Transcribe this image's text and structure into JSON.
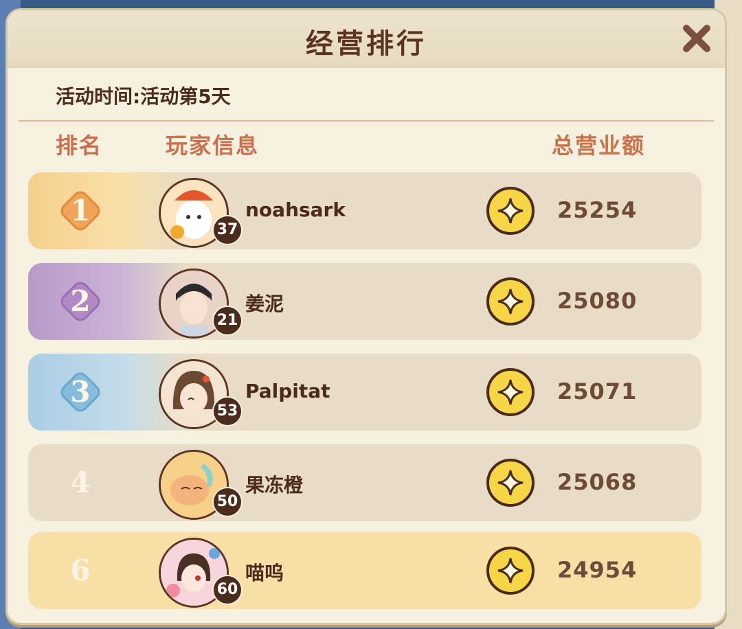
{
  "title": "经营排行",
  "event_time": "活动时间:活动第5天",
  "columns": {
    "rank": "排名",
    "player": "玩家信息",
    "total": "总营业额"
  },
  "colors": {
    "gold": "#f0a45a",
    "purple": "#b189c4",
    "blue": "#86bddc",
    "text_brown": "#4a2b1c",
    "header_orange": "#c9714a"
  },
  "rows": [
    {
      "rank": "1",
      "name": "noahsark",
      "level": "37",
      "amount": "25254",
      "style": "gold",
      "avatar_icon": "ghost-avatar-icon"
    },
    {
      "rank": "2",
      "name": "姜泥",
      "level": "21",
      "amount": "25080",
      "style": "purple",
      "avatar_icon": "man-avatar-icon"
    },
    {
      "rank": "3",
      "name": "Palpitat",
      "level": "53",
      "amount": "25071",
      "style": "blue",
      "avatar_icon": "woman-avatar-icon"
    },
    {
      "rank": "4",
      "name": "果冻橙",
      "level": "50",
      "amount": "25068",
      "style": "plain",
      "avatar_icon": "creature-avatar-icon"
    },
    {
      "rank": "6",
      "name": "喵呜",
      "level": "60",
      "amount": "24954",
      "style": "me",
      "avatar_icon": "girl-avatar-icon"
    }
  ]
}
